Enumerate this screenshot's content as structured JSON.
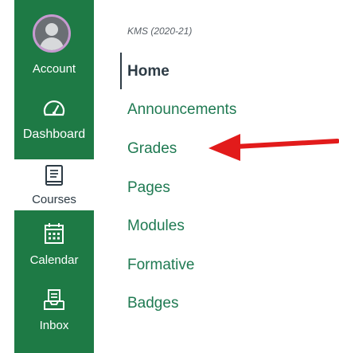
{
  "global_nav": {
    "account": {
      "label": "Account",
      "icon": "user-avatar-icon"
    },
    "dashboard": {
      "label": "Dashboard",
      "icon": "speedometer-icon"
    },
    "courses": {
      "label": "Courses",
      "icon": "book-icon"
    },
    "calendar": {
      "label": "Calendar",
      "icon": "calendar-icon"
    },
    "inbox": {
      "label": "Inbox",
      "icon": "inbox-icon"
    }
  },
  "course_nav": {
    "course_title": "KMS (2020-21)",
    "links": [
      {
        "label": "Home",
        "active": true
      },
      {
        "label": "Announcements"
      },
      {
        "label": "Grades"
      },
      {
        "label": "Pages"
      },
      {
        "label": "Modules"
      },
      {
        "label": "Formative"
      },
      {
        "label": "Badges"
      }
    ]
  },
  "colors": {
    "nav_green": "#1e7a45",
    "link_green": "#1f7a52",
    "active_text": "#2d3b45",
    "arrow_red": "#e21b1b"
  }
}
